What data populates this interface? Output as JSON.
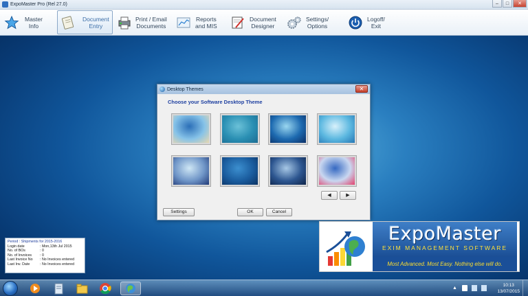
{
  "window": {
    "title": "ExpoMaster Pro (Rel 27.0)",
    "controls": {
      "minimize": "–",
      "maximize": "□",
      "close": "✕"
    }
  },
  "toolbar": {
    "items": [
      {
        "line1": "Master",
        "line2": "Info",
        "icon": "star-icon"
      },
      {
        "line1": "Document",
        "line2": "Entry",
        "icon": "document-icon",
        "active": true
      },
      {
        "line1": "Print / Email",
        "line2": "Documents",
        "icon": "printer-icon"
      },
      {
        "line1": "Reports",
        "line2": "and MIS",
        "icon": "chart-icon"
      },
      {
        "line1": "Document",
        "line2": "Designer",
        "icon": "designer-icon"
      },
      {
        "line1": "Settings/",
        "line2": "Options",
        "icon": "gears-icon"
      },
      {
        "line1": "Logoff/",
        "line2": "Exit",
        "icon": "power-icon"
      }
    ]
  },
  "dialog": {
    "title": "Desktop Themes",
    "close": "✕",
    "heading": "Choose your Software Desktop Theme",
    "prev": "◀",
    "next": "▶",
    "buttons": {
      "settings": "Settings",
      "ok": "OK",
      "cancel": "Cancel"
    },
    "themes": [
      {
        "name": "beach",
        "colors": [
          "#2b6fb8",
          "#87c3e8",
          "#e8d8b0"
        ]
      },
      {
        "name": "flower",
        "colors": [
          "#6bc1d8",
          "#2a8fb3",
          "#1c6c92"
        ]
      },
      {
        "name": "deep-blue-glow",
        "colors": [
          "#9ad7f0",
          "#1d6ab0",
          "#0b2f66"
        ]
      },
      {
        "name": "light-blue-glow",
        "colors": [
          "#d8f1fb",
          "#5cb8e0",
          "#2677b5"
        ]
      },
      {
        "name": "blue-shadow",
        "colors": [
          "#cfe7f5",
          "#6f95c7",
          "#213a78"
        ]
      },
      {
        "name": "blue-swoosh",
        "colors": [
          "#3c8fcf",
          "#1a5c9e",
          "#0b3364"
        ]
      },
      {
        "name": "dark-blue",
        "colors": [
          "#a7c8e6",
          "#2d5690",
          "#0e2449"
        ]
      },
      {
        "name": "blue-pink",
        "colors": [
          "#3569c2",
          "#c9d7f0",
          "#e2426d"
        ]
      }
    ]
  },
  "info": {
    "period": "Period : Shipments for 2015-2016",
    "rows": [
      {
        "key": "Login date",
        "value": ": Mon,13th Jul 2015"
      },
      {
        "key": "No. of BOs",
        "value": ": 0"
      },
      {
        "key": "No. of Invoices",
        "value": ": 0"
      },
      {
        "key": "Last Invoice No",
        "value": ": No Invoices entered"
      },
      {
        "key": "Last Inv. Date",
        "value": ": No Invoices entered"
      }
    ]
  },
  "banner": {
    "title": "ExpoMaster",
    "subtitle": "EXIM MANAGEMENT SOFTWARE",
    "slogan": "Most Advanced. Most Easy. Nothing else will do."
  },
  "taskbar": {
    "apps": [
      "explorer-icon",
      "media-player-icon",
      "notepad-icon",
      "folder-icon",
      "chrome-icon",
      "expomaster-icon"
    ],
    "time": "10:13",
    "date": "13/07/2015"
  },
  "colors": {
    "toolbar_active_text": "#3d6fa8",
    "dialog_heading": "#1d3fa0",
    "banner_blue": "#1a4f98",
    "banner_yellow": "#ffdf2e"
  }
}
